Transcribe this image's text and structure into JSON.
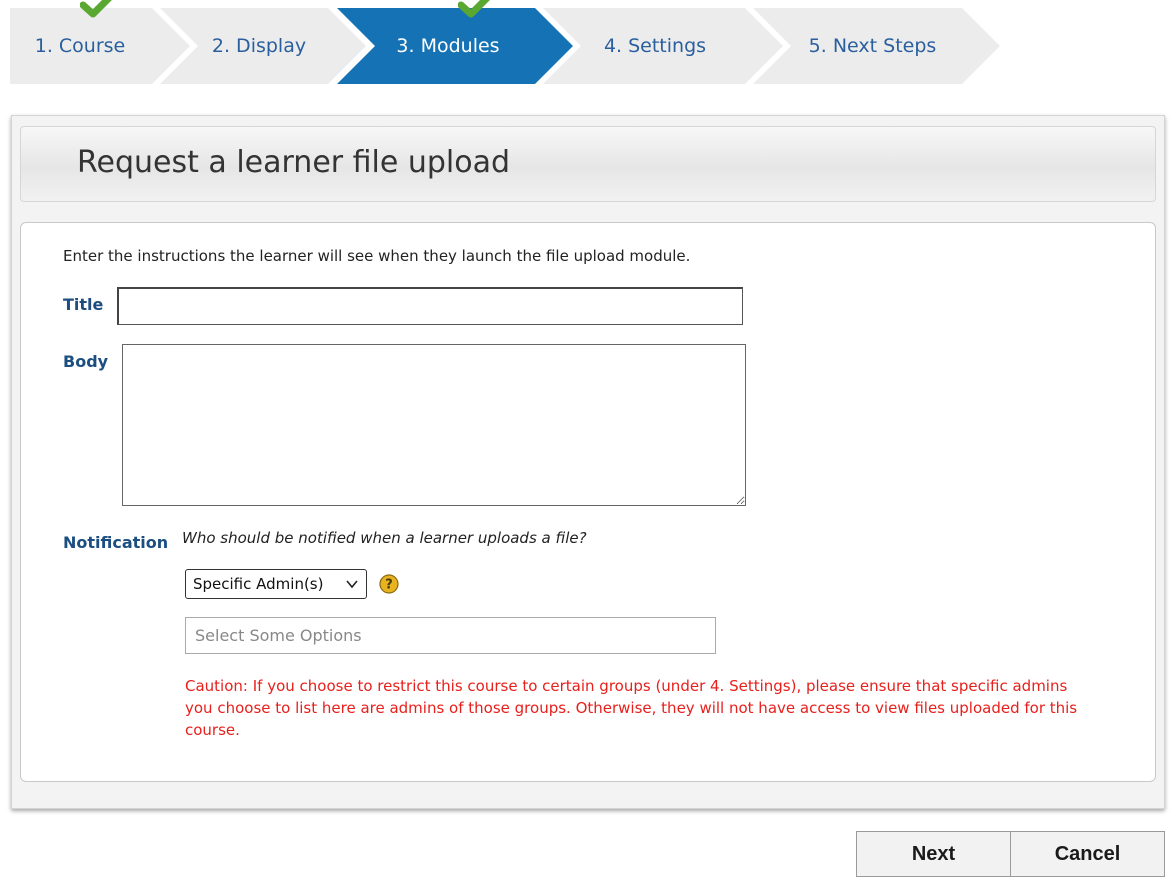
{
  "wizard": {
    "steps": [
      {
        "label": "1. Course",
        "completed": true,
        "active": false
      },
      {
        "label": "2. Display",
        "completed": false,
        "active": false
      },
      {
        "label": "3. Modules",
        "completed": true,
        "active": true
      },
      {
        "label": "4. Settings",
        "completed": false,
        "active": false
      },
      {
        "label": "5. Next Steps",
        "completed": false,
        "active": false
      }
    ]
  },
  "panel": {
    "title": "Request a learner file upload"
  },
  "form": {
    "intro": "Enter the instructions the learner will see when they launch the file upload module.",
    "title_label": "Title",
    "title_value": "",
    "body_label": "Body",
    "body_value": "",
    "notification_label": "Notification",
    "notification_question": "Who should be notified when a learner uploads a file?",
    "notify_select_value": "Specific Admin(s)",
    "admins_placeholder": "Select Some Options",
    "caution": "Caution: If you choose to restrict this course to certain groups (under 4. Settings), please ensure that specific admins you choose to list here are admins of those groups. Otherwise, they will not have access to view files uploaded for this course."
  },
  "buttons": {
    "next": "Next",
    "cancel": "Cancel"
  },
  "colors": {
    "active_step": "#1573b5",
    "step_text": "#2a5f9e",
    "label": "#1c4e80",
    "caution": "#e8201c",
    "check": "#5aa832"
  },
  "icons": {
    "check": "checkmark-icon",
    "help": "help-icon",
    "chevron": "chevron-down-icon"
  }
}
